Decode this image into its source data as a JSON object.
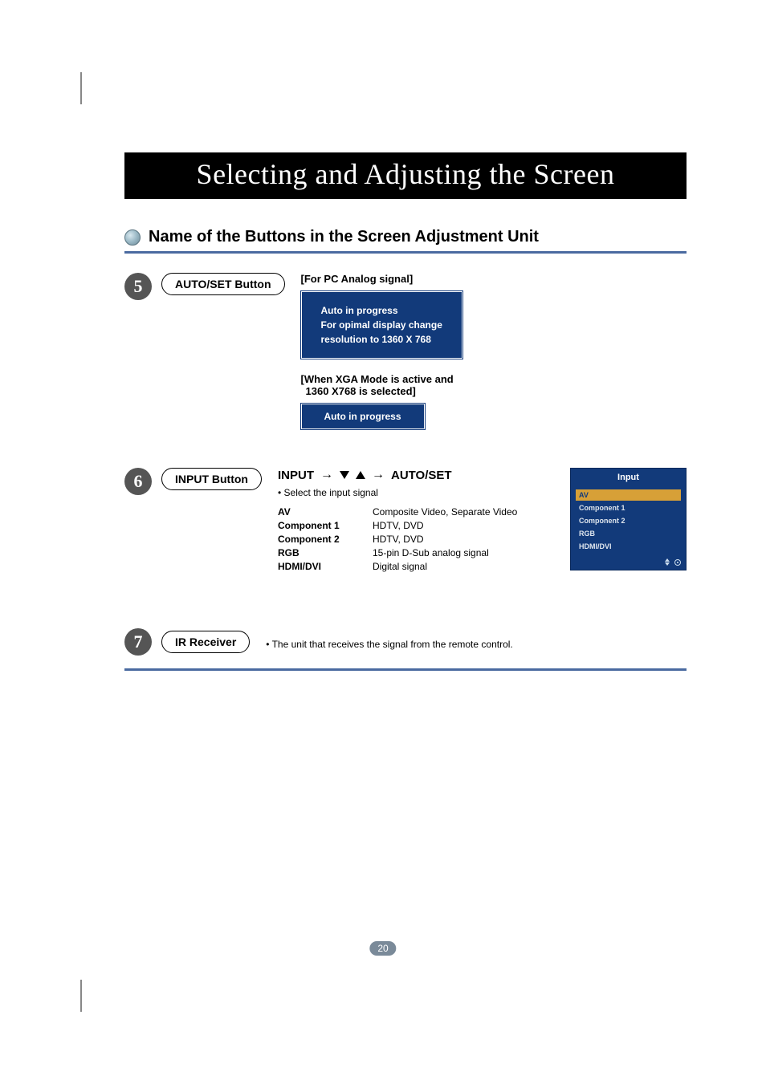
{
  "title": "Selecting and Adjusting the Screen",
  "subhead": "Name of the Buttons in the Screen Adjustment Unit",
  "page_number": "20",
  "sections": {
    "s5": {
      "num": "5",
      "pill": "AUTO/SET Button",
      "label1": "[For PC Analog signal]",
      "box1_l1": "Auto in progress",
      "box1_l2": "For opimal display change",
      "box1_l3": "resolution to 1360 X 768",
      "label2_l1": "[When XGA Mode is active and",
      "label2_l2": "1360 X768 is selected]",
      "box2": "Auto in progress"
    },
    "s6": {
      "num": "6",
      "pill": "INPUT Button",
      "flow_a": "INPUT",
      "flow_b": "AUTO/SET",
      "bullet": "• Select the input signal",
      "rows": [
        {
          "k": "AV",
          "v": "Composite Video, Separate Video"
        },
        {
          "k": "Component 1",
          "v": "HDTV, DVD"
        },
        {
          "k": "Component 2",
          "v": "HDTV, DVD"
        },
        {
          "k": "RGB",
          "v": "15-pin D-Sub analog signal"
        },
        {
          "k": "HDMI/DVI",
          "v": "Digital signal"
        }
      ],
      "osd": {
        "title": "Input",
        "items": [
          "AV",
          "Component 1",
          "Component 2",
          "RGB",
          "HDMI/DVI"
        ],
        "selected": 0
      }
    },
    "s7": {
      "num": "7",
      "pill": "IR Receiver",
      "text": "• The unit that receives the signal from the remote control."
    }
  }
}
